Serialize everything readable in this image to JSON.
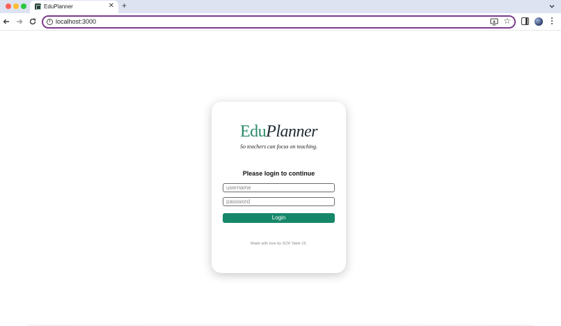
{
  "browser": {
    "tab": {
      "title": "EduPlanner",
      "close_glyph": "✕",
      "favicon": "eduplanner-favicon-icon"
    },
    "new_tab_glyph": "+",
    "address": {
      "url": "localhost:3000",
      "info_glyph": "i"
    },
    "star_glyph": "☆",
    "colors": {
      "tabstrip": "#dde3f0",
      "omnibox_focus": "#7b3a8c"
    }
  },
  "login_card": {
    "logo": {
      "part1": "Edu",
      "part2": "Planner"
    },
    "tagline": "So teachers can focus on teaching.",
    "heading": "Please login to continue",
    "username_placeholder": "username",
    "password_placeholder": "password",
    "login_button": "Login",
    "footer": "Made with love by SCR Table 15.",
    "colors": {
      "brand_green": "#2a8a68",
      "button": "#17876a"
    }
  }
}
